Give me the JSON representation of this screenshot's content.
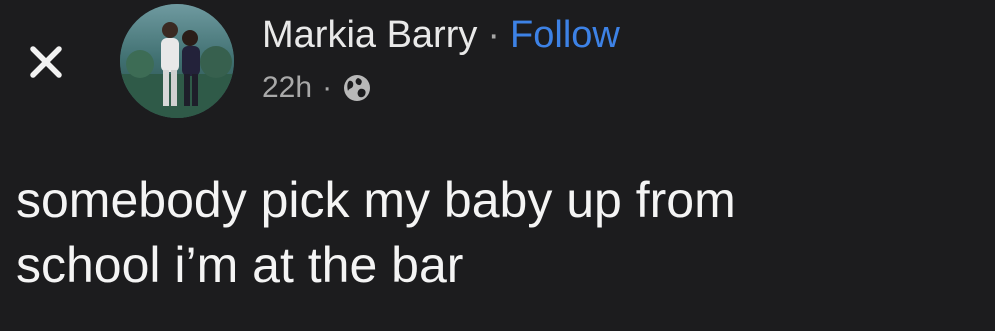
{
  "post": {
    "author_name": "Markia Barry",
    "separator": "·",
    "follow_label": "Follow",
    "timestamp": "22h",
    "meta_separator": "·",
    "privacy_icon": "globe-icon",
    "body_lines": [
      "somebody pick my baby up from",
      "school i’m at the bar"
    ]
  },
  "icons": {
    "close": "close-icon",
    "avatar": "profile-photo"
  },
  "colors": {
    "background": "#1c1c1e",
    "text": "#f4f4f4",
    "secondary_text": "#a9a9a9",
    "follow_link": "#3d82e6"
  }
}
